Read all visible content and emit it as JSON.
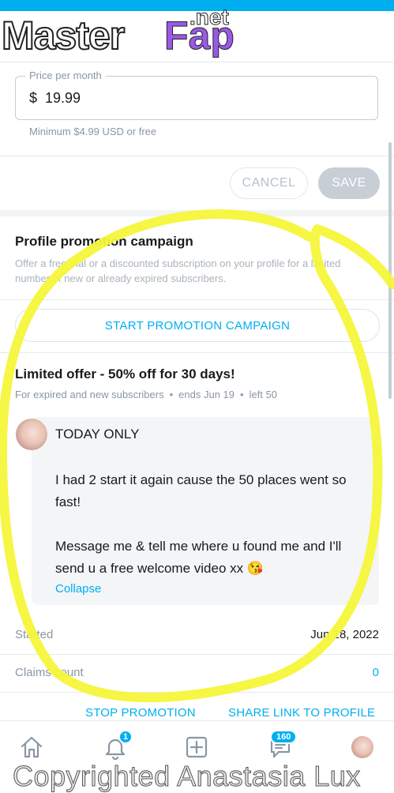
{
  "logo": {
    "part1": "Master",
    "part2": "Fap",
    "part3": ".net"
  },
  "price": {
    "label": "Price per month",
    "value": "$  19.99",
    "hint": "Minimum $4.99 USD or free"
  },
  "actions": {
    "cancel": "CANCEL",
    "save": "SAVE"
  },
  "promotion": {
    "title": "Profile promotion campaign",
    "description": "Offer a free trial or a discounted subscription on your profile for a limited number of new or already expired subscribers.",
    "start_button": "START PROMOTION CAMPAIGN"
  },
  "offer": {
    "title": "Limited offer - 50% off for 30 days!",
    "audience": "For expired and new subscribers",
    "ends": "ends Jun 19",
    "left": "left 50",
    "message_title": "TODAY ONLY",
    "message_p1": "I had 2 start it again cause the 50 places went so fast!",
    "message_p2": "Message me & tell me where u found me and I'll send u a free welcome video xx 😘",
    "collapse": "Collapse",
    "started_label": "Started",
    "started_value": "Jun 18, 2022",
    "claims_label": "Claims count",
    "claims_value": "0",
    "stop": "STOP PROMOTION",
    "share": "SHARE LINK TO PROFILE"
  },
  "nav": {
    "notifications_badge": "1",
    "messages_badge": "160",
    "icons": [
      "home-icon",
      "bell-icon",
      "add-post-icon",
      "messages-icon",
      "profile-avatar"
    ]
  },
  "watermark": "Copyrighted Anastasia Lux",
  "colors": {
    "accent": "#00aff0",
    "scribble": "#f5f53a"
  }
}
